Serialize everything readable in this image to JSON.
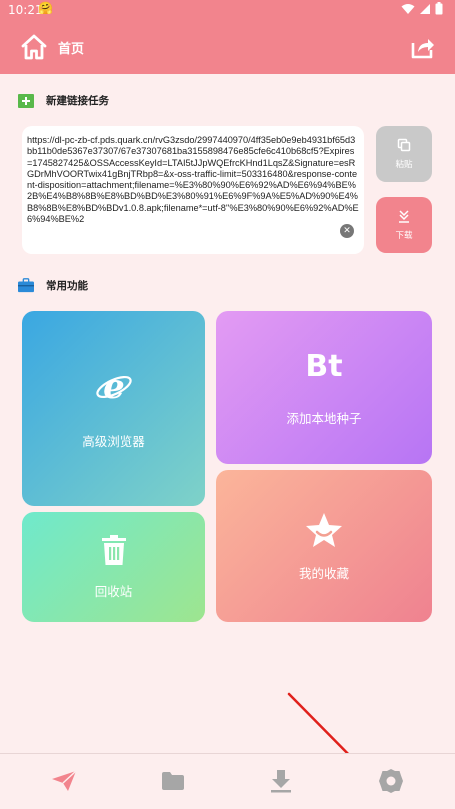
{
  "status_bar": {
    "time": "10:21",
    "emoji": "🤗"
  },
  "app_bar": {
    "title": "首页",
    "home_icon": "home-icon",
    "share_icon": "share-icon"
  },
  "new_task": {
    "title": "新建链接任务",
    "url_text": "https://dl-pc-zb-cf.pds.quark.cn/rvG3zsdo/2997440970/4ff35eb0e9eb4931bf65d3bb11b0de5367e37307/67e37307681ba3155898476e85cfe6c410b68cf5?Expires=1745827425&OSSAccessKeyId=LTAI5tJJpWQEfrcKHnd1LqsZ&Signature=esRGDrMhVOORTwix41gBnjTRbp8=&x-oss-traffic-limit=503316480&response-content-disposition=attachment;filename=%E3%80%90%E6%92%AD%E6%94%BE%2B%E4%B8%8B%E8%BD%BD%E3%80%91%E6%9F%9A%E5%AD%90%E4%B8%8B%E8%BD%BDv1.0.8.apk;filename*=utf-8''%E3%80%90%E6%92%AD%E6%94%BE%2",
    "paste_label": "粘贴",
    "download_label": "下载"
  },
  "features": {
    "title": "常用功能",
    "browser_label": "高级浏览器",
    "bt_text": "Bt",
    "seed_label": "添加本地种子",
    "recycle_label": "回收站",
    "favorites_label": "我的收藏"
  },
  "bottom_nav": [
    "send-icon",
    "folder-icon",
    "download-icon",
    "settings-icon"
  ],
  "colors": {
    "accent": "#f2848d",
    "background": "#fdeeee",
    "annotation_arrow": "#e0201b"
  }
}
